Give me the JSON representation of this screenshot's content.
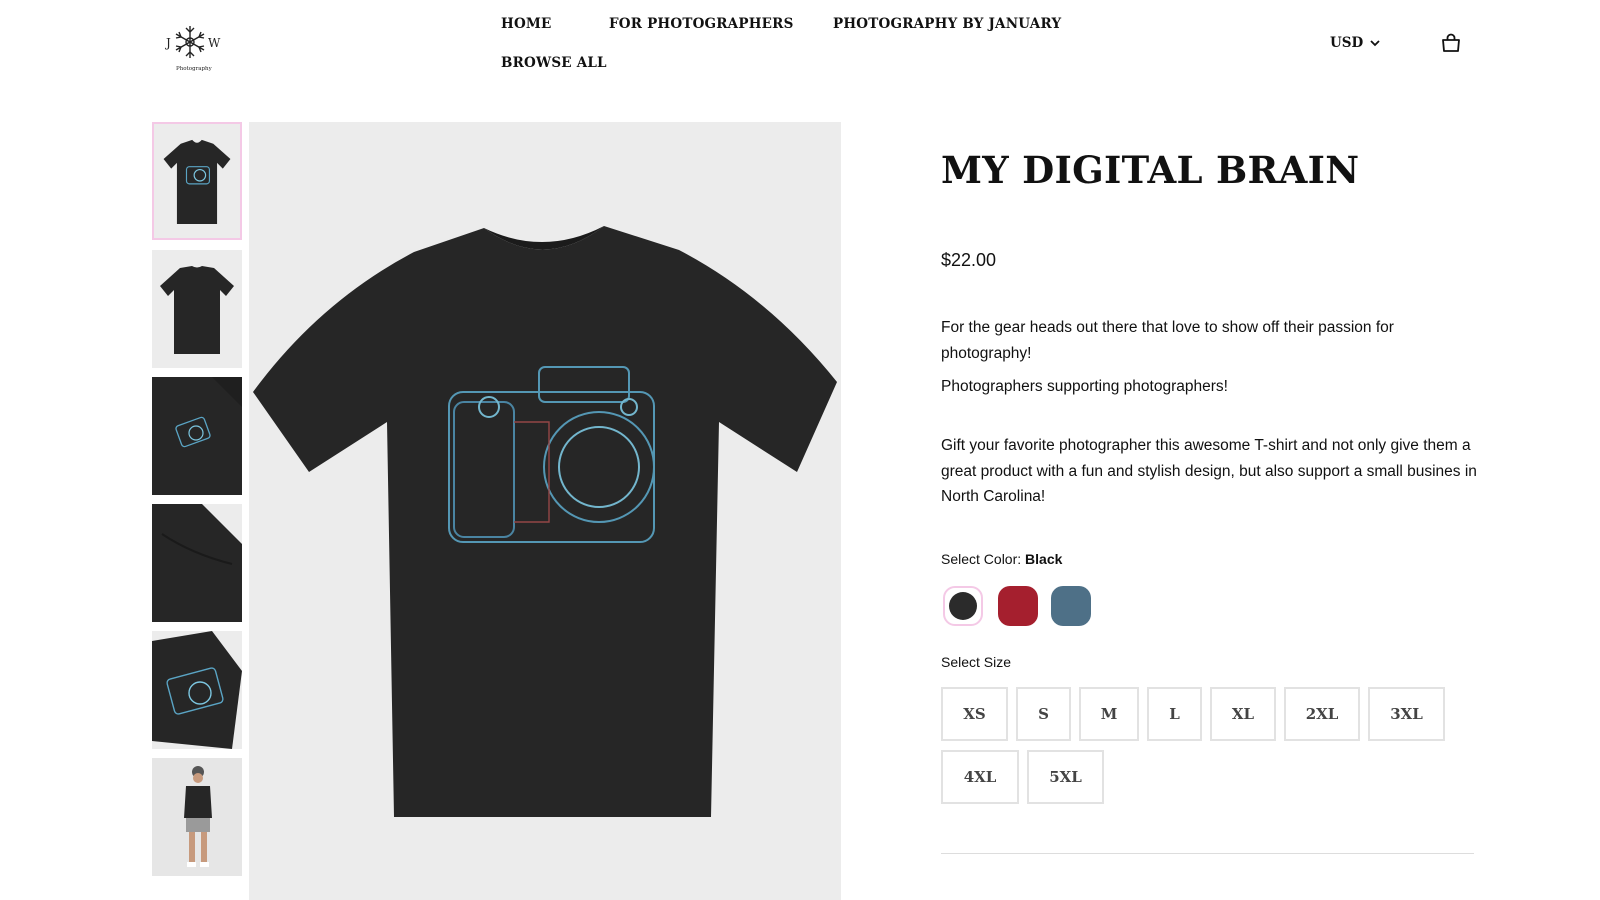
{
  "header": {
    "logo_text": "J W Photography",
    "nav": [
      "HOME",
      "FOR PHOTOGRAPHERS",
      "PHOTOGRAPHY BY JANUARY",
      "BROWSE ALL"
    ],
    "currency": "USD",
    "icons": {
      "currency_dropdown": "chevron-down-icon",
      "cart": "shopping-bag-icon"
    }
  },
  "gallery": {
    "thumbnails": [
      {
        "label": "front",
        "active": true
      },
      {
        "label": "back",
        "active": false
      },
      {
        "label": "folded-print",
        "active": false
      },
      {
        "label": "folded-back",
        "active": false
      },
      {
        "label": "print-closeup",
        "active": false
      },
      {
        "label": "model",
        "active": false
      }
    ]
  },
  "product": {
    "title": "MY DIGITAL BRAIN",
    "price": "$22.00",
    "description": [
      "For the gear heads out there that love to show off their passion for photography!",
      "Photographers supporting photographers!",
      "Gift your favorite photographer this awesome T-shirt and not only give them a great product with a fun and stylish design, but also support a small busines in North Carolina!"
    ],
    "color_label": "Select Color:",
    "selected_color": "Black",
    "colors": [
      {
        "name": "Black",
        "hex": "#2b2b2b"
      },
      {
        "name": "Red",
        "hex": "#a51f2e"
      },
      {
        "name": "Blue",
        "hex": "#4e7087"
      }
    ],
    "size_label": "Select Size",
    "sizes": [
      "XS",
      "S",
      "M",
      "L",
      "XL",
      "2XL",
      "3XL",
      "4XL",
      "5XL"
    ]
  },
  "colors": {
    "active_border": "#f4c9e6",
    "image_bg": "#ececec",
    "shirt": "#262626"
  }
}
